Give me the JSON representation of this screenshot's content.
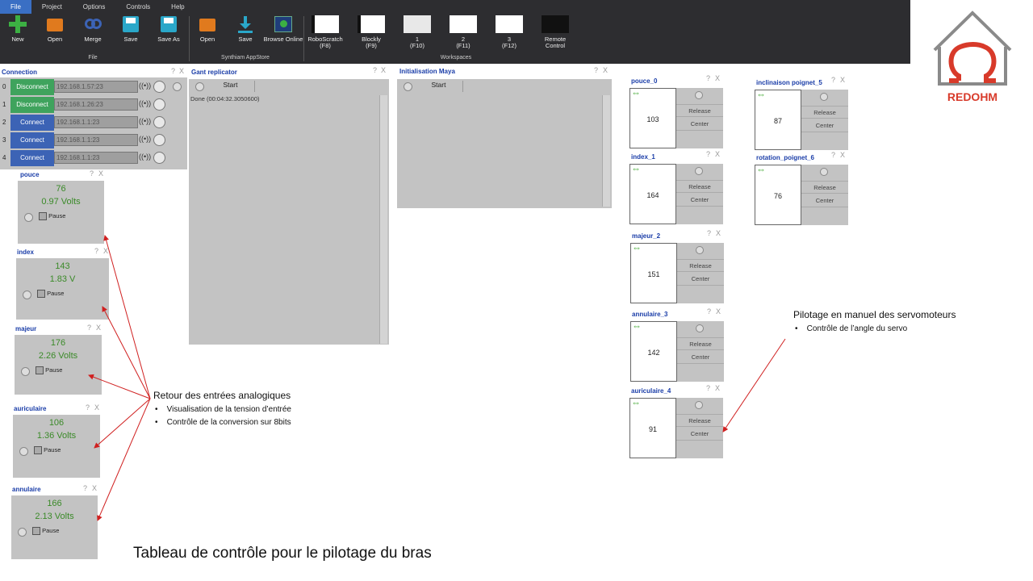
{
  "menu": [
    "File",
    "Project",
    "Options",
    "Controls",
    "Help"
  ],
  "ribbon": {
    "file_group": {
      "label": "File",
      "buttons": [
        "New",
        "Open",
        "Merge",
        "Save",
        "Save As"
      ]
    },
    "appstore_group": {
      "label": "Synthiam AppStore",
      "buttons": [
        "Open",
        "Save",
        "Browse Online"
      ]
    },
    "workspaces_group": {
      "label": "Workspaces",
      "buttons": [
        {
          "name": "RoboScratch",
          "key": "(F8)"
        },
        {
          "name": "Blockly",
          "key": "(F9)"
        },
        {
          "name": "1",
          "key": "(F10)"
        },
        {
          "name": "2",
          "key": "(F11)"
        },
        {
          "name": "3",
          "key": "(F12)"
        },
        {
          "name": "Remote Control",
          "key": ""
        }
      ]
    }
  },
  "logo_text": "REDOHM",
  "connection": {
    "title": "Connection",
    "rows": [
      {
        "index": "0",
        "button": "Disconnect",
        "ip": "192.168.1.57:23",
        "color": "#3fa35d"
      },
      {
        "index": "1",
        "button": "Disconnect",
        "ip": "192.168.1.26:23",
        "color": "#3fa35d"
      },
      {
        "index": "2",
        "button": "Connect",
        "ip": "192.168.1.1:23",
        "color": "#3c63b5"
      },
      {
        "index": "3",
        "button": "Connect",
        "ip": "192.168.1.1:23",
        "color": "#3c63b5"
      },
      {
        "index": "4",
        "button": "Connect",
        "ip": "192.168.1.1:23",
        "color": "#3c63b5"
      }
    ]
  },
  "gant": {
    "title": "Gant replicator",
    "start": "Start",
    "log": "Done (00:04:32.3050600)"
  },
  "maya": {
    "title": "Initialisation Maya",
    "start": "Start"
  },
  "analog": [
    {
      "title": "pouce",
      "value": "76",
      "volts": "0.97 Volts",
      "pause": "Pause"
    },
    {
      "title": "index",
      "value": "143",
      "volts": "1.83 V",
      "pause": "Pause"
    },
    {
      "title": "majeur",
      "value": "176",
      "volts": "2.26 Volts",
      "pause": "Pause"
    },
    {
      "title": "auriculaire",
      "value": "106",
      "volts": "1.36 Volts",
      "pause": "Pause"
    },
    {
      "title": "annulaire",
      "value": "166",
      "volts": "2.13 Volts",
      "pause": "Pause"
    }
  ],
  "servos": [
    {
      "title": "pouce_0",
      "value": "103",
      "release": "Release",
      "center": "Center"
    },
    {
      "title": "index_1",
      "value": "164",
      "release": "Release",
      "center": "Center"
    },
    {
      "title": "majeur_2",
      "value": "151",
      "release": "Release",
      "center": "Center"
    },
    {
      "title": "annulaire_3",
      "value": "142",
      "release": "Release",
      "center": "Center"
    },
    {
      "title": "auriculaire_4",
      "value": "91",
      "release": "Release",
      "center": "Center"
    },
    {
      "title": "inclinaison poignet_5",
      "value": "87",
      "release": "Release",
      "center": "Center"
    },
    {
      "title": "rotation_poignet_6",
      "value": "76",
      "release": "Release",
      "center": "Center"
    }
  ],
  "panel_help": "?",
  "panel_close": "X",
  "annotations": {
    "analog_title": "Retour des entrées analogiques",
    "analog_bullets": [
      "Visualisation de la tension d’entrée",
      "Contrôle de la conversion sur 8bits"
    ],
    "servo_title": "Pilotage en manuel  des servomoteurs",
    "servo_bullets": [
      "Contrôle de l’angle du servo"
    ],
    "caption": "Tableau de contrôle pour le pilotage du bras"
  }
}
